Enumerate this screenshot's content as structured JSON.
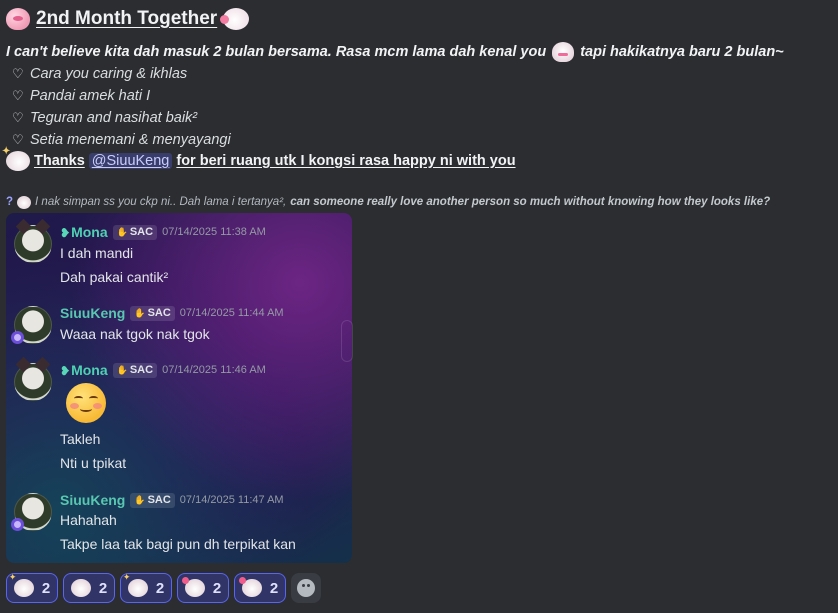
{
  "post": {
    "title": "2nd Month Together",
    "intro": "I can't believe kita dah masuk 2 bulan bersama. Rasa mcm lama dah kenal you",
    "intro_tail": "tapi hakikatnya baru 2 bulan~",
    "bullets": [
      "Cara you caring & ikhlas",
      "Pandai amek hati I",
      "Teguran and nasihat baik²",
      "Setia menemani & menyayangi"
    ],
    "bullet_glyph": "♡",
    "thanks_prefix": "Thanks",
    "mention": "@SiuuKeng",
    "thanks_suffix": "for beri ruang utk I kongsi rasa happy ni with you",
    "question_mark": "?",
    "question_italic": "I nak simpan ss you ckp ni.. Dah lama i tertanya²,",
    "question_bold": "can someone really love another person so much without knowing how they looks like?"
  },
  "screenshot": {
    "tag_label": "SAC",
    "messages": [
      {
        "user": "Mona",
        "time": "07/14/2025 11:38 AM",
        "lines": [
          "I dah mandi",
          "Dah pakai cantik²"
        ]
      },
      {
        "user": "SiuuKeng",
        "time": "07/14/2025 11:44 AM",
        "lines": [
          "Waaa nak tgok nak tgok"
        ]
      },
      {
        "user": "Mona",
        "time": "07/14/2025 11:46 AM",
        "lines": [
          "Takleh",
          "Nti u tpikat"
        ]
      },
      {
        "user": "SiuuKeng",
        "time": "07/14/2025 11:47 AM",
        "lines": [
          "Hahahah",
          "Takpe laa tak bagi pun dh terpikat kan"
        ]
      }
    ]
  },
  "reactions": [
    {
      "icon": "sparkle-bunny-icon",
      "count": "2"
    },
    {
      "icon": "bunny-icon",
      "count": "2"
    },
    {
      "icon": "sparkle-bunny-icon",
      "count": "2"
    },
    {
      "icon": "heart-bunny-icon",
      "count": "2"
    },
    {
      "icon": "heart-bunny-icon",
      "count": "2"
    }
  ],
  "colors": {
    "background": "#2b2d31",
    "mention_bg": "#5865f2",
    "username": "#4fd1b4"
  }
}
